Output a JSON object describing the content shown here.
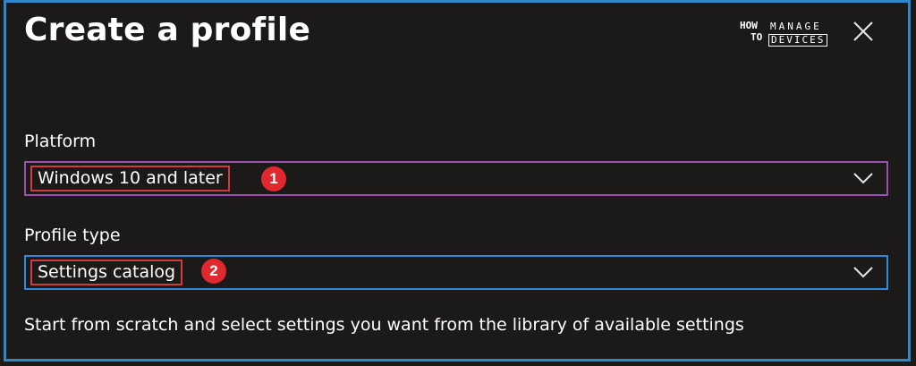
{
  "panel": {
    "title": "Create a profile"
  },
  "logo": {
    "how": "HOW",
    "to": "TO",
    "manage": "MANAGE",
    "devices": "DEVICES"
  },
  "icons": {
    "close": "close-icon",
    "dropdown": "chevron-down-icon"
  },
  "platform": {
    "label": "Platform",
    "value": "Windows 10 and later",
    "annotation": "1"
  },
  "profile_type": {
    "label": "Profile type",
    "value": "Settings catalog",
    "annotation": "2"
  },
  "description": "Start from scratch and select settings you want from the library of available settings",
  "colors": {
    "background": "#1b1a19",
    "frame_border": "#2f86c8",
    "platform_border": "#9b4fb5",
    "profile_border": "#2b8ae0",
    "annotation": "#e0282e"
  }
}
